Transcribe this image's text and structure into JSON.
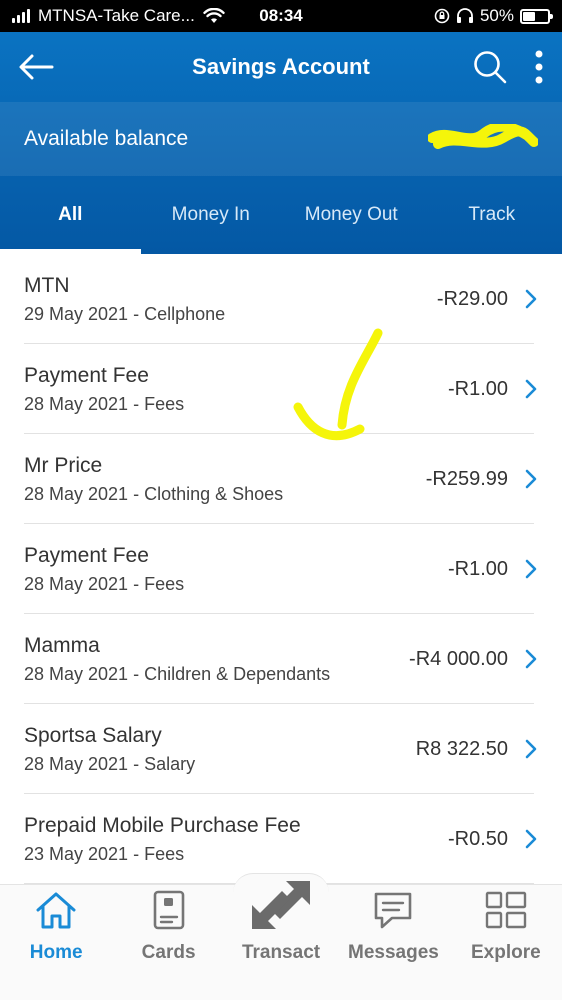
{
  "status_bar": {
    "carrier": "MTNSA-Take Care...",
    "time": "08:34",
    "battery": "50%"
  },
  "header": {
    "title": "Savings Account",
    "balance_label": "Available balance"
  },
  "tabs": [
    {
      "label": "All",
      "active": true
    },
    {
      "label": "Money In",
      "active": false
    },
    {
      "label": "Money Out",
      "active": false
    },
    {
      "label": "Track",
      "active": false
    }
  ],
  "transactions": [
    {
      "name": "MTN",
      "meta": "29 May 2021 - Cellphone",
      "amount": "-R29.00"
    },
    {
      "name": "Payment Fee",
      "meta": "28 May 2021 - Fees",
      "amount": "-R1.00"
    },
    {
      "name": "Mr Price",
      "meta": "28 May 2021 - Clothing & Shoes",
      "amount": "-R259.99"
    },
    {
      "name": "Payment Fee",
      "meta": "28 May 2021 - Fees",
      "amount": "-R1.00"
    },
    {
      "name": "Mamma",
      "meta": "28 May 2021 - Children & Dependants",
      "amount": "-R4 000.00"
    },
    {
      "name": "Sportsa Salary",
      "meta": "28 May 2021 - Salary",
      "amount": "R8 322.50"
    },
    {
      "name": "Prepaid Mobile Purchase Fee",
      "meta": "23 May 2021 - Fees",
      "amount": "-R0.50"
    }
  ],
  "bottom_nav": [
    {
      "label": "Home",
      "icon": "home-icon",
      "active": true
    },
    {
      "label": "Cards",
      "icon": "card-icon",
      "active": false
    },
    {
      "label": "Transact",
      "icon": "transact-arrows-icon",
      "active": false
    },
    {
      "label": "Messages",
      "icon": "message-icon",
      "active": false
    },
    {
      "label": "Explore",
      "icon": "grid-icon",
      "active": false
    }
  ],
  "colors": {
    "header_blue": "#0763b0",
    "accent": "#1a8bd6",
    "annotation_yellow": "#f5f50a"
  }
}
